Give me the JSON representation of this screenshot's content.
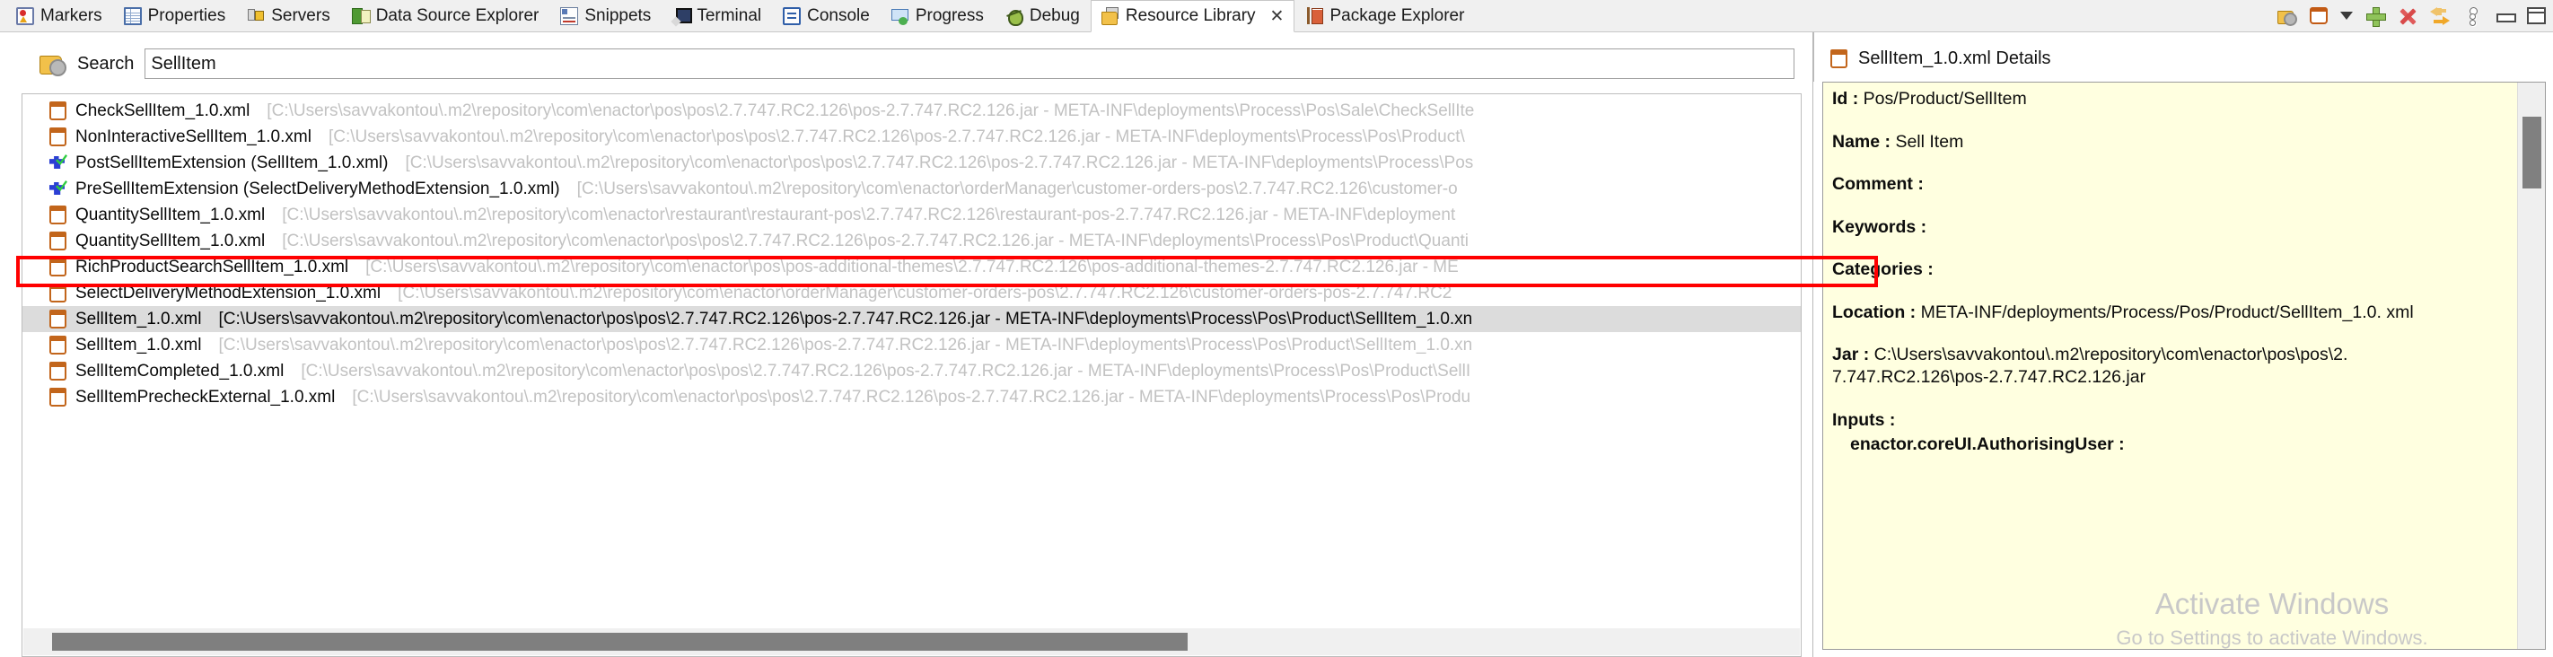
{
  "tabbar": {
    "tabs": [
      {
        "label": "Markers",
        "icon": "markers-icon",
        "active": false
      },
      {
        "label": "Properties",
        "icon": "properties-icon",
        "active": false
      },
      {
        "label": "Servers",
        "icon": "servers-icon",
        "active": false
      },
      {
        "label": "Data Source Explorer",
        "icon": "data-source-explorer-icon",
        "active": false
      },
      {
        "label": "Snippets",
        "icon": "snippets-icon",
        "active": false
      },
      {
        "label": "Terminal",
        "icon": "terminal-icon",
        "active": false
      },
      {
        "label": "Console",
        "icon": "console-icon",
        "active": false
      },
      {
        "label": "Progress",
        "icon": "progress-icon",
        "active": false
      },
      {
        "label": "Debug",
        "icon": "debug-icon",
        "active": false
      },
      {
        "label": "Resource Library",
        "icon": "resource-library-icon",
        "active": true,
        "close": "✕"
      },
      {
        "label": "Package Explorer",
        "icon": "package-explorer-icon",
        "active": false
      }
    ],
    "toolbar": [
      {
        "name": "search-resources-icon"
      },
      {
        "name": "view-menu-box-icon"
      },
      {
        "name": "chevron-down-icon"
      },
      {
        "name": "add-icon"
      },
      {
        "name": "delete-icon"
      },
      {
        "name": "swap-arrows-icon"
      },
      {
        "name": "view-menu-icon"
      },
      {
        "name": "minimize-icon"
      },
      {
        "name": "maximize-icon"
      }
    ]
  },
  "search": {
    "label": "Search",
    "value": "SellItem",
    "placeholder": ""
  },
  "results": [
    {
      "name": "CheckSellItem_1.0.xml",
      "path": "[C:\\Users\\savvakontou\\.m2\\repository\\com\\enactor\\pos\\pos\\2.7.747.RC2.126\\pos-2.7.747.RC2.126.jar - META-INF\\deployments\\Process\\Pos\\Sale\\CheckSellIte",
      "icon": "document",
      "selected": false
    },
    {
      "name": "NonInteractiveSellItem_1.0.xml",
      "path": "[C:\\Users\\savvakontou\\.m2\\repository\\com\\enactor\\pos\\pos\\2.7.747.RC2.126\\pos-2.7.747.RC2.126.jar - META-INF\\deployments\\Process\\Pos\\Product\\",
      "icon": "document",
      "selected": false
    },
    {
      "name": "PostSellItemExtension (SellItem_1.0.xml)",
      "path": "[C:\\Users\\savvakontou\\.m2\\repository\\com\\enactor\\pos\\pos\\2.7.747.RC2.126\\pos-2.7.747.RC2.126.jar - META-INF\\deployments\\Process\\Pos",
      "icon": "extension",
      "selected": false
    },
    {
      "name": "PreSellItemExtension (SelectDeliveryMethodExtension_1.0.xml)",
      "path": "[C:\\Users\\savvakontou\\.m2\\repository\\com\\enactor\\orderManager\\customer-orders-pos\\2.7.747.RC2.126\\customer-o",
      "icon": "extension",
      "selected": false
    },
    {
      "name": "QuantitySellItem_1.0.xml",
      "path": "[C:\\Users\\savvakontou\\.m2\\repository\\com\\enactor\\restaurant\\restaurant-pos\\2.7.747.RC2.126\\restaurant-pos-2.7.747.RC2.126.jar - META-INF\\deployment",
      "icon": "document",
      "selected": false
    },
    {
      "name": "QuantitySellItem_1.0.xml",
      "path": "[C:\\Users\\savvakontou\\.m2\\repository\\com\\enactor\\pos\\pos\\2.7.747.RC2.126\\pos-2.7.747.RC2.126.jar - META-INF\\deployments\\Process\\Pos\\Product\\Quanti",
      "icon": "document",
      "selected": false
    },
    {
      "name": "RichProductSearchSellItem_1.0.xml",
      "path": "[C:\\Users\\savvakontou\\.m2\\repository\\com\\enactor\\pos\\pos-additional-themes\\2.7.747.RC2.126\\pos-additional-themes-2.7.747.RC2.126.jar - ME",
      "icon": "document",
      "selected": false
    },
    {
      "name": "SelectDeliveryMethodExtension_1.0.xml",
      "path": "[C:\\Users\\savvakontou\\.m2\\repository\\com\\enactor\\orderManager\\customer-orders-pos\\2.7.747.RC2.126\\customer-orders-pos-2.7.747.RC2",
      "icon": "document",
      "selected": false
    },
    {
      "name": "SellItem_1.0.xml",
      "path": "[C:\\Users\\savvakontou\\.m2\\repository\\com\\enactor\\pos\\pos\\2.7.747.RC2.126\\pos-2.7.747.RC2.126.jar - META-INF\\deployments\\Process\\Pos\\Product\\SellItem_1.0.xn",
      "icon": "document",
      "selected": true
    },
    {
      "name": "SellItem_1.0.xml",
      "path": "[C:\\Users\\savvakontou\\.m2\\repository\\com\\enactor\\pos\\pos\\2.7.747.RC2.126\\pos-2.7.747.RC2.126.jar - META-INF\\deployments\\Process\\Pos\\Product\\SellItem_1.0.xn",
      "icon": "document",
      "selected": false
    },
    {
      "name": "SellItemCompleted_1.0.xml",
      "path": "[C:\\Users\\savvakontou\\.m2\\repository\\com\\enactor\\pos\\pos\\2.7.747.RC2.126\\pos-2.7.747.RC2.126.jar - META-INF\\deployments\\Process\\Pos\\Product\\SellI",
      "icon": "document",
      "selected": false
    },
    {
      "name": "SellItemPrecheckExternal_1.0.xml",
      "path": "[C:\\Users\\savvakontou\\.m2\\repository\\com\\enactor\\pos\\pos\\2.7.747.RC2.126\\pos-2.7.747.RC2.126.jar - META-INF\\deployments\\Process\\Pos\\Produ",
      "icon": "document",
      "selected": false
    }
  ],
  "details": {
    "title": "SellItem_1.0.xml Details",
    "fields": [
      {
        "label": "Id :",
        "value": "Pos/Product/SellItem"
      },
      {
        "label": "Name :",
        "value": "Sell Item"
      },
      {
        "label": "Comment :",
        "value": ""
      },
      {
        "label": "Keywords :",
        "value": ""
      },
      {
        "label": "Categories :",
        "value": ""
      },
      {
        "label": "Location :",
        "value": "META-INF/deployments/Process/Pos/Product/SellItem_1.0. xml"
      },
      {
        "label": "Jar :",
        "value": "C:\\Users\\savvakontou\\.m2\\repository\\com\\enactor\\pos\\pos\\2. 7.747.RC2.126\\pos-2.7.747.RC2.126.jar"
      },
      {
        "label": "Inputs :",
        "value": ""
      }
    ],
    "input_entries": [
      "enactor.coreUI.AuthorisingUser :"
    ]
  },
  "watermark": {
    "title": "Activate Windows",
    "subtitle": "Go to Settings to activate Windows."
  },
  "colors": {
    "selection": "#dcdcdc",
    "highlight": "#ff0000",
    "details_bg": "#ffffe0",
    "doc_icon": "#c2651b",
    "ext_icon": "#2b3fd4"
  }
}
